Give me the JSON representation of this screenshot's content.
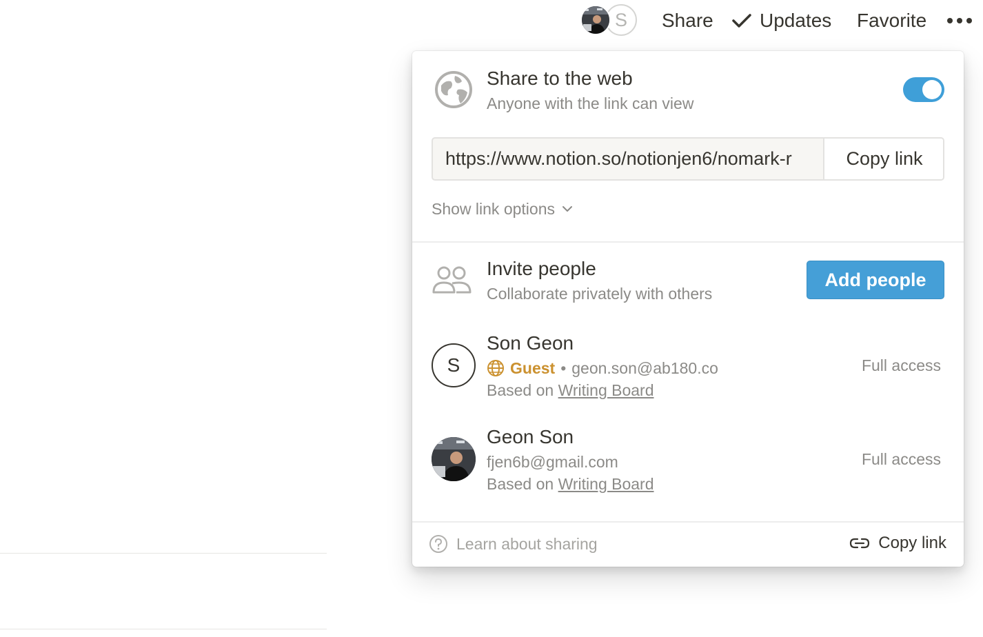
{
  "topbar": {
    "avatar_initial": "S",
    "share_label": "Share",
    "updates_label": "Updates",
    "favorite_label": "Favorite"
  },
  "popup": {
    "web": {
      "title": "Share to the web",
      "subtitle": "Anyone with the link can view",
      "toggle_on": true,
      "url": "https://www.notion.so/notionjen6/nomark-r",
      "copy_label": "Copy link",
      "show_options_label": "Show link options"
    },
    "invite": {
      "title": "Invite people",
      "subtitle": "Collaborate privately with others",
      "button_label": "Add people"
    },
    "members": [
      {
        "initial": "S",
        "name": "Son Geon",
        "role": "Guest",
        "separator": "•",
        "email": "geon.son@ab180.co",
        "based_prefix": "Based on",
        "based_link": "Writing Board",
        "access": "Full access"
      },
      {
        "name": "Geon Son",
        "email": "fjen6b@gmail.com",
        "based_prefix": "Based on",
        "based_link": "Writing Board",
        "access": "Full access"
      }
    ],
    "footer": {
      "learn_label": "Learn about sharing",
      "copy_label": "Copy link"
    }
  },
  "colors": {
    "toggle": "#3f9fd8",
    "add_button": "#459fd7",
    "guest": "#cb912f",
    "text": "#37352f",
    "muted": "#8b8a87"
  },
  "icons": [
    "globe-icon",
    "people-icon",
    "checkmark-icon",
    "more-icon",
    "chevron-down-icon",
    "question-icon",
    "link-icon"
  ]
}
